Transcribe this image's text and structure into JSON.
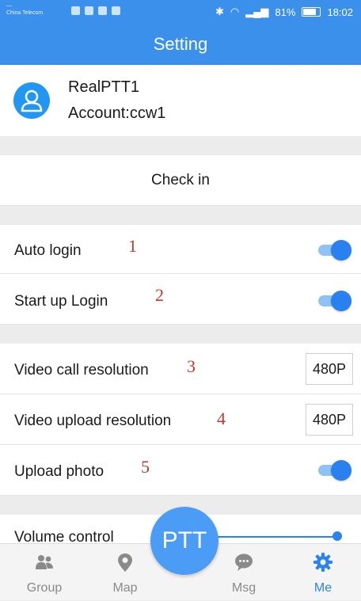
{
  "status_bar": {
    "carrier": "China Telecom",
    "battery": "81%",
    "time": "18:02"
  },
  "app_bar": {
    "title": "Setting"
  },
  "profile": {
    "name": "RealPTT1",
    "account": "Account:ccw1"
  },
  "check_in": {
    "label": "Check in"
  },
  "settings": {
    "auto_login": {
      "label": "Auto login",
      "marker": "1",
      "enabled": true
    },
    "startup_login": {
      "label": "Start up Login",
      "marker": "2",
      "enabled": true
    },
    "video_call_resolution": {
      "label": "Video call resolution",
      "marker": "3",
      "value": "480P"
    },
    "video_upload_resolution": {
      "label": "Video upload resolution",
      "marker": "4",
      "value": "480P"
    },
    "upload_photo": {
      "label": "Upload photo",
      "marker": "5",
      "enabled": true
    },
    "volume_control": {
      "label": "Volume control",
      "level": 1.0
    }
  },
  "ptt_button": {
    "label": "PTT"
  },
  "bottom_nav": {
    "items": [
      {
        "label": "Group",
        "icon": "group-icon"
      },
      {
        "label": "Map",
        "icon": "map-pin-icon"
      },
      {
        "label": "Msg",
        "icon": "message-icon"
      },
      {
        "label": "Me",
        "icon": "gear-icon",
        "active": true
      }
    ]
  },
  "colors": {
    "primary": "#3a90ea",
    "toggle_on": "#2980ef",
    "annotation": "#c0392b"
  }
}
